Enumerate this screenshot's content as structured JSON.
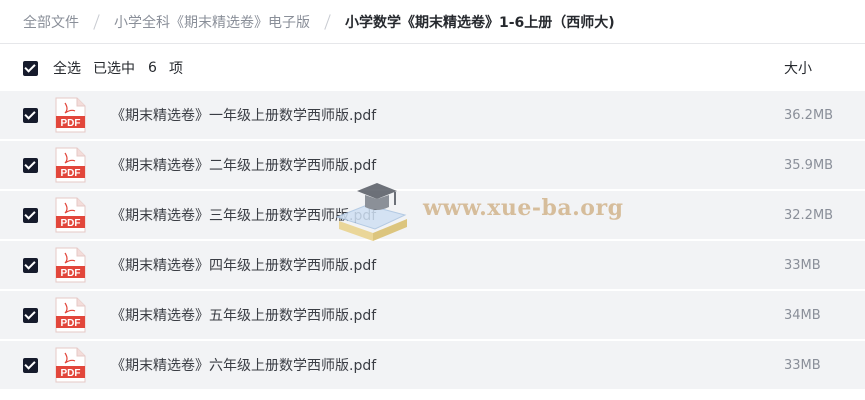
{
  "breadcrumb": [
    {
      "label": "全部文件"
    },
    {
      "label": "小学全科《期末精选卷》电子版"
    },
    {
      "label": "小学数学《期末精选卷》1-6上册（西师大)"
    }
  ],
  "header": {
    "select_all_label": "全选",
    "selected_text": "已选中",
    "selected_count": "6",
    "selected_unit": "项",
    "size_column": "大小"
  },
  "files": [
    {
      "name": "《期末精选卷》一年级上册数学西师版.pdf",
      "size": "36.2MB",
      "icon_label": "PDF",
      "checked": true
    },
    {
      "name": "《期末精选卷》二年级上册数学西师版.pdf",
      "size": "35.9MB",
      "icon_label": "PDF",
      "checked": true
    },
    {
      "name": "《期末精选卷》三年级上册数学西师版.pdf",
      "size": "32.2MB",
      "icon_label": "PDF",
      "checked": true
    },
    {
      "name": "《期末精选卷》四年级上册数学西师版.pdf",
      "size": "33MB",
      "icon_label": "PDF",
      "checked": true
    },
    {
      "name": "《期末精选卷》五年级上册数学西师版.pdf",
      "size": "34MB",
      "icon_label": "PDF",
      "checked": true
    },
    {
      "name": "《期末精选卷》六年级上册数学西师版.pdf",
      "size": "33MB",
      "icon_label": "PDF",
      "checked": true
    }
  ],
  "watermark": {
    "text": "www.xue-ba.org"
  },
  "colors": {
    "accent": "#161b2c",
    "pdf_red": "#e2463b",
    "row_bg": "#f2f3f5"
  }
}
